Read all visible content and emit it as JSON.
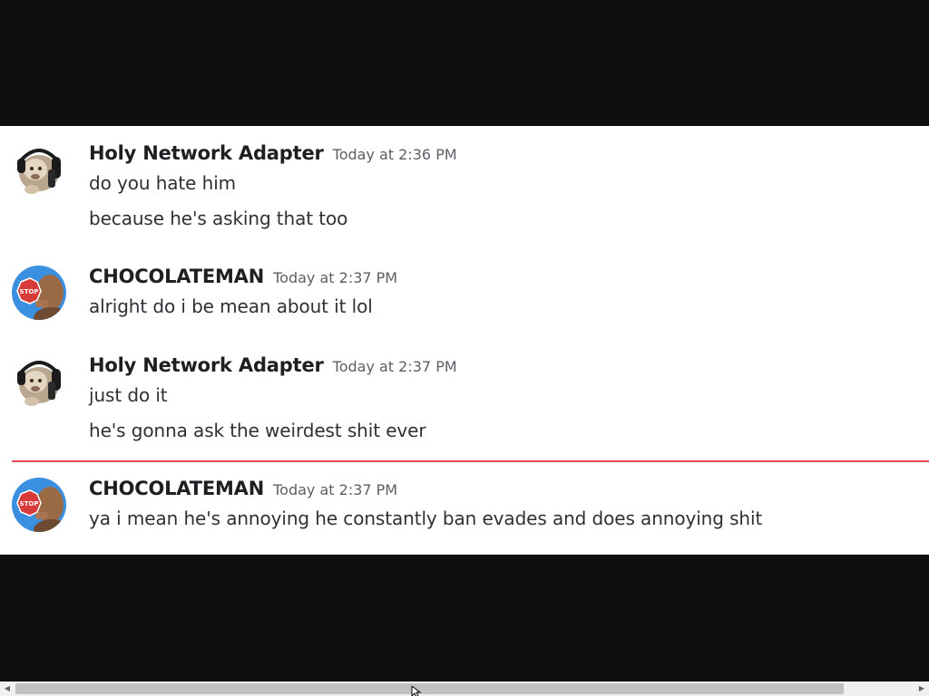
{
  "messages": [
    {
      "author": "Holy Network Adapter",
      "timestamp": "Today at 2:36 PM",
      "avatar": "hamster-headphones-avatar",
      "lines": [
        "do you hate him",
        "because he's asking that too"
      ]
    },
    {
      "author": "CHOCOLATEMAN",
      "timestamp": "Today at 2:37 PM",
      "avatar": "stop-sign-man-avatar",
      "lines": [
        "alright do i be mean about it lol"
      ]
    },
    {
      "author": "Holy Network Adapter",
      "timestamp": "Today at 2:37 PM",
      "avatar": "hamster-headphones-avatar",
      "lines": [
        "just do it",
        "he's gonna ask the weirdest shit ever"
      ]
    },
    {
      "author": "CHOCOLATEMAN",
      "timestamp": "Today at 2:37 PM",
      "avatar": "stop-sign-man-avatar",
      "lines": [
        "ya i mean he's annoying he constantly ban evades and does annoying shit"
      ]
    }
  ],
  "avatar_stop_text": "STOP",
  "colors": {
    "background": "#0f0f10",
    "panel": "#ffffff",
    "username": "#1e1f22",
    "timestamp": "#5c5e66",
    "message_text": "#2e3035",
    "new_messages_divider": "#e2475a",
    "scrollbar_track": "#f0f0f0",
    "scrollbar_thumb": "#c1c1c1"
  }
}
